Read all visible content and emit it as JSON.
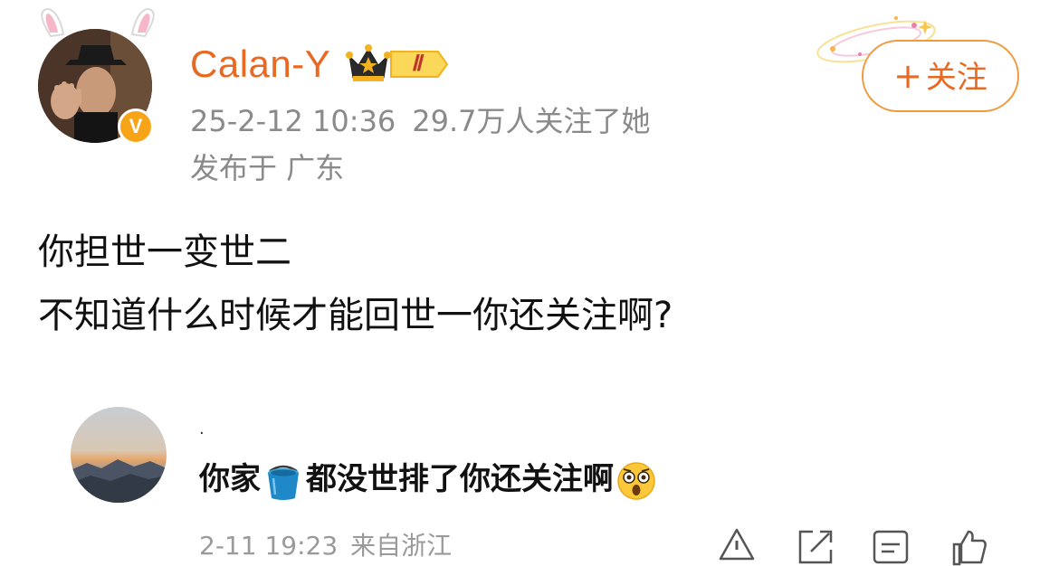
{
  "post": {
    "author": {
      "name": "Calan-Y",
      "verified_mark": "V",
      "level_badge": "Ⅱ",
      "avatar_icon": "avatar-man-hat",
      "crown_icon": "crown-icon"
    },
    "timestamp": "25-2-12 10:36",
    "followers_text": "29.7万人关注了她",
    "location_text": "发布于 广东",
    "follow_button": {
      "icon": "+",
      "label": "关注"
    },
    "content_lines": [
      "你担世一变世二",
      "不知道什么时候才能回世一你还关注啊?"
    ]
  },
  "comment": {
    "author_mark": "·",
    "text_before_icon": "你家",
    "icon_bucket": "bucket-icon",
    "text_after_icon": "都没世排了你还关注啊",
    "emoji": "astonished-face-emoji",
    "timestamp": "2-11 19:23",
    "source_text": "来自浙江",
    "actions": [
      "report-icon",
      "share-icon",
      "comment-icon",
      "like-icon"
    ]
  },
  "colors": {
    "accent": "#e86a22",
    "follow_border": "#f09a3e",
    "meta_gray": "#8a8a8a",
    "badge_orange": "#f7a418"
  }
}
